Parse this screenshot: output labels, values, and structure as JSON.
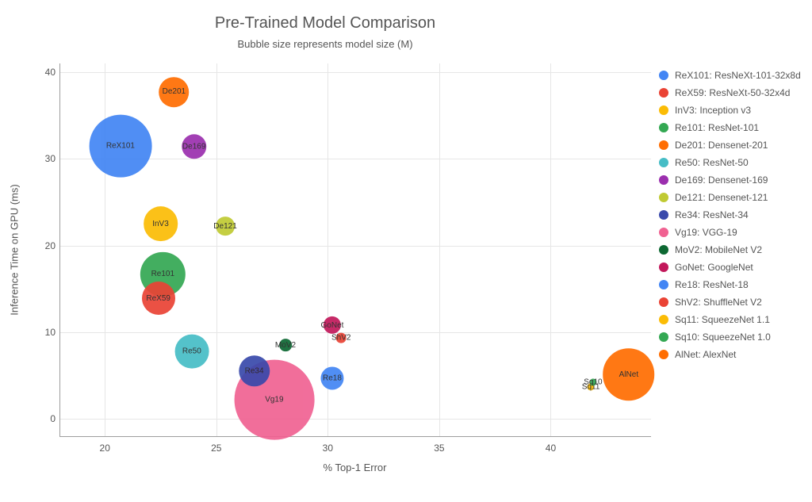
{
  "title": "Pre-Trained Model Comparison",
  "subtitle": "Bubble size represents model size (M)",
  "xlabel": "% Top-1 Error",
  "ylabel": "Inference Time on GPU (ms)",
  "x_ticks": [
    20,
    25,
    30,
    35,
    40
  ],
  "y_ticks": [
    0,
    10,
    20,
    30,
    40
  ],
  "xlim": [
    18,
    44.5
  ],
  "ylim": [
    -2,
    41
  ],
  "chart_data": {
    "type": "bubble",
    "x_field": "top1_error_pct",
    "y_field": "inference_time_ms",
    "size_field": "model_size_M",
    "points": [
      {
        "short": "ReX101",
        "full": "ResNeXt-101-32x8d",
        "top1_error_pct": 20.7,
        "inference_time_ms": 31.5,
        "model_size_M": 88,
        "color": "#4285f4"
      },
      {
        "short": "ReX59",
        "full": "ResNeXt-50-32x4d",
        "top1_error_pct": 22.4,
        "inference_time_ms": 13.9,
        "model_size_M": 25,
        "color": "#ea4335"
      },
      {
        "short": "InV3",
        "full": "Inception v3",
        "top1_error_pct": 22.5,
        "inference_time_ms": 22.5,
        "model_size_M": 27,
        "color": "#fbbc05"
      },
      {
        "short": "Re101",
        "full": "ResNet-101",
        "top1_error_pct": 22.6,
        "inference_time_ms": 16.7,
        "model_size_M": 45,
        "color": "#34a853"
      },
      {
        "short": "De201",
        "full": "Densenet-201",
        "top1_error_pct": 23.1,
        "inference_time_ms": 37.7,
        "model_size_M": 20,
        "color": "#ff6d01"
      },
      {
        "short": "Re50",
        "full": "ResNet-50",
        "top1_error_pct": 23.9,
        "inference_time_ms": 7.8,
        "model_size_M": 26,
        "color": "#46bdc6"
      },
      {
        "short": "De169",
        "full": "Densenet-169",
        "top1_error_pct": 24.0,
        "inference_time_ms": 31.4,
        "model_size_M": 14,
        "color": "#9b2fae"
      },
      {
        "short": "De121",
        "full": "Densenet-121",
        "top1_error_pct": 25.4,
        "inference_time_ms": 22.2,
        "model_size_M": 8,
        "color": "#c0ca33"
      },
      {
        "short": "Re34",
        "full": "ResNet-34",
        "top1_error_pct": 26.7,
        "inference_time_ms": 5.5,
        "model_size_M": 22,
        "color": "#3949ab"
      },
      {
        "short": "Vg19",
        "full": "VGG-19",
        "top1_error_pct": 27.6,
        "inference_time_ms": 2.2,
        "model_size_M": 144,
        "color": "#f06292"
      },
      {
        "short": "MoV2",
        "full": "MobileNet V2",
        "top1_error_pct": 28.1,
        "inference_time_ms": 8.5,
        "model_size_M": 3.5,
        "color": "#0d6832"
      },
      {
        "short": "GoNet",
        "full": "GoogleNet",
        "top1_error_pct": 30.2,
        "inference_time_ms": 10.8,
        "model_size_M": 7,
        "color": "#c2185b"
      },
      {
        "short": "Re18",
        "full": "ResNet-18",
        "top1_error_pct": 30.2,
        "inference_time_ms": 4.7,
        "model_size_M": 12,
        "color": "#4285f4"
      },
      {
        "short": "ShV2",
        "full": "ShuffleNet V2",
        "top1_error_pct": 30.6,
        "inference_time_ms": 9.3,
        "model_size_M": 2.3,
        "color": "#ea4335"
      },
      {
        "short": "Sq11",
        "full": "SqueezeNet 1.1",
        "top1_error_pct": 41.8,
        "inference_time_ms": 3.7,
        "model_size_M": 1.2,
        "color": "#fbbc05"
      },
      {
        "short": "Sq10",
        "full": "SqueezeNet 1.0",
        "top1_error_pct": 41.9,
        "inference_time_ms": 4.2,
        "model_size_M": 1.2,
        "color": "#34a853"
      },
      {
        "short": "AlNet",
        "full": "AlexNet",
        "top1_error_pct": 43.5,
        "inference_time_ms": 5.1,
        "model_size_M": 61,
        "color": "#ff6d01"
      }
    ]
  }
}
